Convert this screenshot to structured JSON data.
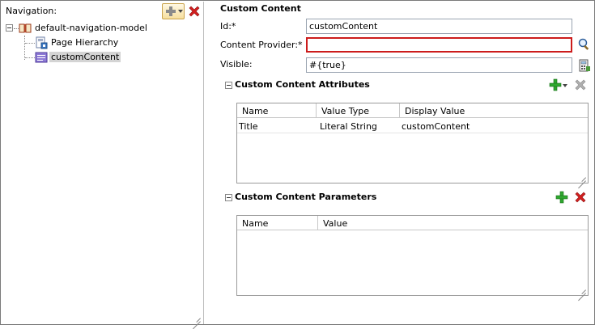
{
  "navigation": {
    "title": "Navigation:",
    "tree": {
      "root_label": "default-navigation-model",
      "children": [
        {
          "label": "Page Hierarchy"
        },
        {
          "label": "customContent"
        }
      ]
    }
  },
  "form": {
    "section_title": "Custom Content",
    "id_label": "Id:*",
    "id_value": "customContent",
    "provider_label": "Content Provider:*",
    "provider_value": "",
    "visible_label": "Visible:",
    "visible_value": "#{true}",
    "attributes": {
      "title": "Custom Content Attributes",
      "columns": [
        "Name",
        "Value Type",
        "Display Value"
      ],
      "rows": [
        {
          "name": "Title",
          "value_type": "Literal String",
          "display_value": "customContent"
        }
      ]
    },
    "parameters": {
      "title": "Custom Content Parameters",
      "columns": [
        "Name",
        "Value"
      ],
      "rows": []
    }
  },
  "colors": {
    "add_green": "#2fa82f",
    "delete_red": "#d32020",
    "error_border": "#cc1c1c",
    "selection_bg": "#d4d4d4"
  }
}
